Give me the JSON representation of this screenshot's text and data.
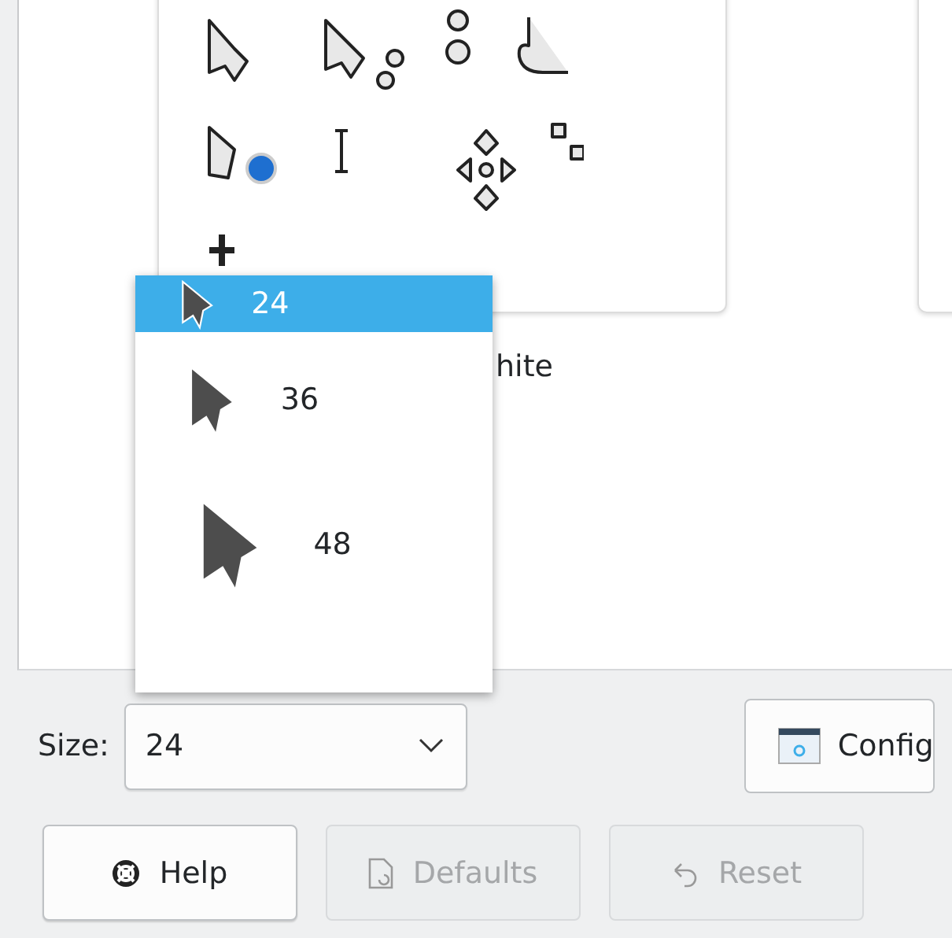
{
  "theme_preview": {
    "label": "hite"
  },
  "size_popup": {
    "options": [
      {
        "label": "24",
        "selected": true
      },
      {
        "label": "36",
        "selected": false
      },
      {
        "label": "48",
        "selected": false
      }
    ]
  },
  "size": {
    "label": "Size:",
    "value": "24"
  },
  "configure_button": {
    "label": "Config"
  },
  "buttons": [
    {
      "label": "Help",
      "kind": "help",
      "disabled": false
    },
    {
      "label": "Defaults",
      "kind": "defaults",
      "disabled": true
    },
    {
      "label": "Reset",
      "kind": "reset",
      "disabled": true
    }
  ]
}
